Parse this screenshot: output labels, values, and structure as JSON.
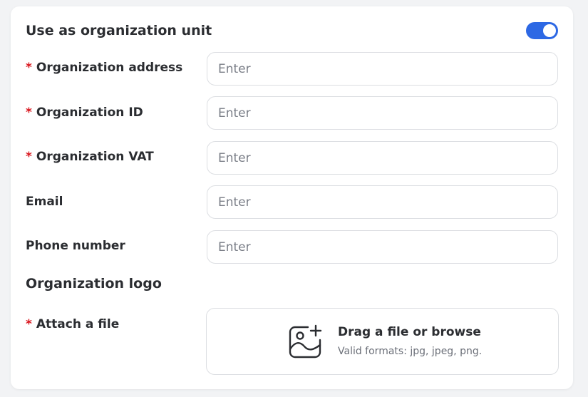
{
  "unit_section": {
    "title": "Use as organization unit",
    "toggle_on": true
  },
  "colors": {
    "accent": "#2d68e4",
    "required": "#d9141c",
    "border": "#dcdee2",
    "background": "#f2f3f5"
  },
  "fields": [
    {
      "label": "Organization address",
      "required": true,
      "value": "",
      "placeholder": "Enter"
    },
    {
      "label": "Organization ID",
      "required": true,
      "value": "",
      "placeholder": "Enter"
    },
    {
      "label": "Organization VAT",
      "required": true,
      "value": "",
      "placeholder": "Enter"
    },
    {
      "label": "Email",
      "required": false,
      "value": "",
      "placeholder": "Enter"
    },
    {
      "label": "Phone number",
      "required": false,
      "value": "",
      "placeholder": "Enter"
    }
  ],
  "logo_section": {
    "title": "Organization logo",
    "attach_label": "Attach a file",
    "attach_required": true,
    "icon": "image-add-icon",
    "drop_title": "Drag a file or browse",
    "drop_hint": "Valid formats: jpg, jpeg, png."
  }
}
